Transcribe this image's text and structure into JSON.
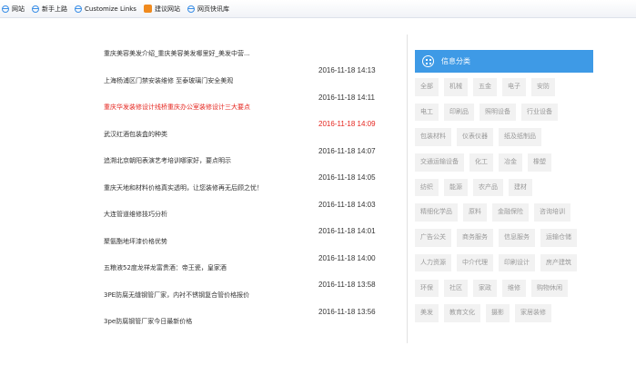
{
  "favorites": [
    {
      "icon": "ie-icon",
      "label": "网站"
    },
    {
      "icon": "ie-icon",
      "label": "新手上路"
    },
    {
      "icon": "ie-icon",
      "label": "Customize Links"
    },
    {
      "icon": "orange-icon",
      "label": "建议网站"
    },
    {
      "icon": "ie-icon",
      "label": "网页快讯库"
    }
  ],
  "news": [
    {
      "title": "重庆美容美发介绍_重庆美容美发哪里好_美发中营...",
      "date": "2016-11-18 14:13",
      "highlight": false
    },
    {
      "title": "上海杨浦区门禁安装维修 至泰玻璃门安全美观",
      "date": "2016-11-18 14:11",
      "highlight": false
    },
    {
      "title": "重庆华发装修设计线桥重庆办公室装修设计三大要点",
      "date": "2016-11-18 14:09",
      "highlight": true
    },
    {
      "title": "武汉红酒包装盒的种类",
      "date": "2016-11-18 14:07",
      "highlight": false
    },
    {
      "title": "追溯北京朝阳表演艺考培训哪家好，要点明示",
      "date": "2016-11-18 14:05",
      "highlight": false
    },
    {
      "title": "重庆天地和材料价格真实透明，让您装修再无后顾之忧！",
      "date": "2016-11-18 14:03",
      "highlight": false
    },
    {
      "title": "大连管道维修技巧分析",
      "date": "2016-11-18 14:01",
      "highlight": false
    },
    {
      "title": "聚氨酯地坪漆价格优势",
      "date": "2016-11-18 14:00",
      "highlight": false
    },
    {
      "title": "五粮液52度龙祥龙富贵酒：帝王瓷，皇家酒",
      "date": "2016-11-18 13:58",
      "highlight": false
    },
    {
      "title": "3PE防腐无缝钢管厂家，内衬不锈钢复合管价格报价",
      "date": "2016-11-18 13:56",
      "highlight": false
    },
    {
      "title": "3pe防腐钢管厂家今日最新价格",
      "date": "",
      "highlight": false
    }
  ],
  "categories": {
    "title": "信息分类",
    "rows": [
      [
        "全部",
        "机械",
        "五金",
        "电子",
        "安防"
      ],
      [
        "电工",
        "印刷品",
        "照明设备",
        "行业设备"
      ],
      [
        "包装材料",
        "仪表仪器",
        "纸及纸制品"
      ],
      [
        "交通运输设备",
        "化工",
        "冶金",
        "橡塑"
      ],
      [
        "纺织",
        "能源",
        "农产品",
        "建材"
      ],
      [
        "精细化学品",
        "原料",
        "金融保险",
        "咨询培训"
      ],
      [
        "广告公关",
        "商务服务",
        "信息服务",
        "运输仓储"
      ],
      [
        "人力资源",
        "中介代理",
        "印刷设计",
        "房产建筑"
      ],
      [
        "环保",
        "社区",
        "家政",
        "维修",
        "购物休闲"
      ],
      [
        "美发",
        "教育文化",
        "摄影",
        "家居装修"
      ]
    ]
  }
}
